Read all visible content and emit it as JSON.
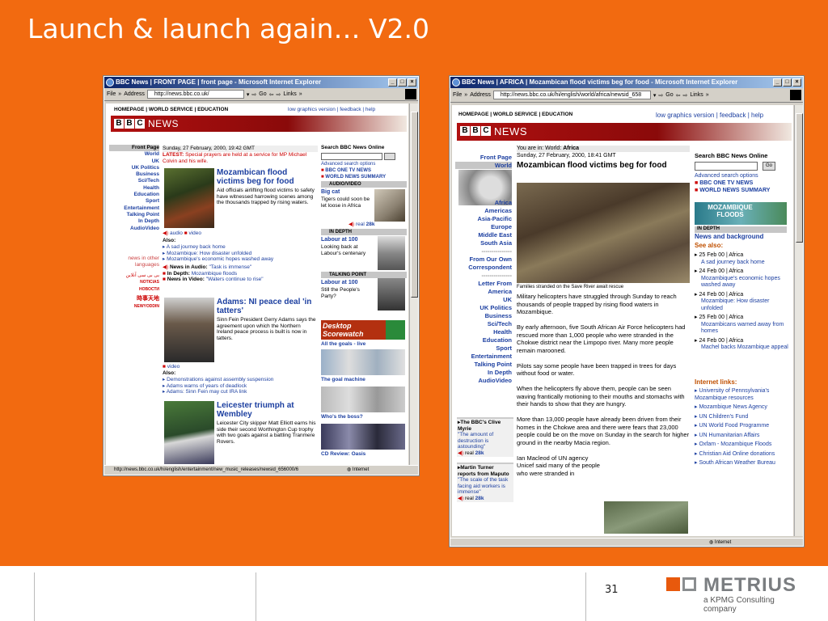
{
  "slide": {
    "title": "Launch & launch again… V2.0",
    "page_number": "31",
    "logo_word": "METRIUS",
    "logo_tag": "a KPMG Consulting company"
  },
  "colors": {
    "slide_bg": "#f26a10",
    "bbc_red": "#b01010",
    "link_blue": "#1c3fa0"
  },
  "left_window": {
    "title": "BBC News | FRONT PAGE | front page - Microsoft Internet Explorer",
    "menu_file": "File",
    "address_label": "Address",
    "address": "http://news.bbc.co.uk/",
    "go": "Go",
    "links": "Links",
    "status_url": "http://news.bbc.co.uk/hi/english/entertainment/new_music_releases/newsid_656000/6",
    "status_zone": "Internet",
    "page": {
      "topnav_left": "HOMEPAGE | WORLD SERVICE | EDUCATION",
      "topnav_right": "low graphics version | feedback | help",
      "brand": [
        "B",
        "B",
        "C"
      ],
      "news": "NEWS",
      "nav": [
        "Front Page",
        "World",
        "UK",
        "UK Politics",
        "Business",
        "Sci/Tech",
        "Health",
        "Education",
        "Sport",
        "Entertainment",
        "Talking Point",
        "In Depth",
        "AudioVideo"
      ],
      "date": "Sunday, 27 February, 2000, 19:42 GMT",
      "latest_label": "LATEST:",
      "latest_text": "Special prayers are held at a service for MP Michael Colvin and his wife.",
      "story1_head": "Mozambican flood victims beg for food",
      "story1_text": "Aid officials airlifting flood victims to safety have witnessed harrowing scenes among the thousands trapped by rising waters.",
      "audio": "audio",
      "video": "video",
      "also": "Also:",
      "also1": [
        "A sad journey back home",
        "Mozambique: How disaster unfolded",
        "Mozambique's economic hopes washed away"
      ],
      "news_in_audio_label": "News in Audio:",
      "news_in_audio": "\"Task is immense\"",
      "in_depth_label": "In Depth:",
      "in_depth": "Mozambique floods",
      "news_in_video_label": "News in Video:",
      "news_in_video": "\"Waters continue to rise\"",
      "other_lang": "news in other languages",
      "lang1": "NOTICIAS",
      "lang2": "НОВОСТИ",
      "lang3": "NEWYODDIN",
      "story2_head": "Adams: NI peace deal 'in tatters'",
      "story2_text": "Sinn Fein President Gerry Adams says the agreement upon which the Northern Ireland peace process is built is now in tatters.",
      "also2": [
        "Demonstrations against assembly suspension",
        "Adams warns of years of deadlock",
        "Adams: Sinn Fein may cut IRA link"
      ],
      "story3_head": "Leicester triumph at Wembley",
      "story3_text": "Leicester City skipper Matt Elliott earns his side their second Worthington Cup trophy with two goals against a battling Tranmere Rovers.",
      "search_label": "Search BBC News Online",
      "adv_search": "Advanced search options",
      "one_tv": "BBC ONE TV NEWS",
      "world_summary": "WORLD NEWS SUMMARY",
      "audio_video_bar": "AUDIO/VIDEO",
      "big_cat": "Big cat",
      "big_cat_text": "Tigers could soon be let loose in Africa",
      "real": "real",
      "real28": "28k",
      "in_depth_bar": "IN DEPTH",
      "labour_head": "Labour at 100",
      "labour_text": "Looking back at Labour's centenary",
      "talking_bar": "TALKING POINT",
      "labour2_head": "Labour at 100",
      "labour2_text": "Still the People's Party?",
      "desktop_ad": "Desktop Scorewatch",
      "all_goals": "All the goals - live",
      "goal_machine": "The goal machine",
      "whos_boss": "Who's the boss?",
      "cd_review": "CD Review: Oasis"
    }
  },
  "right_window": {
    "title": "BBC News | AFRICA | Mozambican flood victims beg for food - Microsoft Internet Explorer",
    "menu_file": "File",
    "address_label": "Address",
    "address": "http://news.bbc.co.uk/hi/english/world/africa/newsid_658",
    "go": "Go",
    "links": "Links",
    "status_zone": "Internet",
    "page": {
      "topnav_left": "HOMEPAGE | WORLD SERVICE | EDUCATION",
      "topnav_right": "low graphics version | feedback | help",
      "brand": [
        "B",
        "B",
        "C"
      ],
      "news": "NEWS",
      "you_are_in": "You are in:",
      "you_world": "World:",
      "you_africa": "Africa",
      "nav_top": [
        "Front Page",
        "World"
      ],
      "nav_world": [
        "Africa",
        "Americas",
        "Asia-Pacific",
        "Europe",
        "Middle East",
        "South Asia"
      ],
      "dash": "---------------",
      "from_our": "From Our Own Correspondent",
      "letter_from": "Letter From America",
      "nav_bottom": [
        "UK",
        "UK Politics",
        "Business",
        "Sci/Tech",
        "Health",
        "Education",
        "Sport",
        "Entertainment",
        "Talking Point",
        "In Depth",
        "AudioVideo"
      ],
      "date": "Sunday, 27 February, 2000, 18:41 GMT",
      "headline": "Mozambican flood victims beg for food",
      "caption": "Families stranded on the Save River await rescue",
      "p1": "Military helicopters have struggled through Sunday to reach thousands of people trapped by rising flood waters in Mozambique.",
      "p2": "By early afternoon, five South African Air Force helicopters had rescued more than 1,000 people who were stranded in the Chokwe district near the Limpopo river. Many more people remain marooned.",
      "p3": "Pilots say some people have been trapped in trees for days without food or water.",
      "p4": "When the helicopters fly above them, people can be seen waving frantically motioning to their mouths and stomachs with their hands to show that they are hungry.",
      "p5": "More than 13,000 people have already been driven from their homes in the Chokwe area and there were fears that 23,000 people could be on the move on Sunday in the search for higher ground in the nearby Macia region.",
      "p6": "Ian Macleod of UN agency Unicef said many of the people who were stranded in",
      "quote1_head": "The BBC's Clive Myrie",
      "quote1": "\"The amount of destruction is astounding\"",
      "quote2_head": "Martin Turner reports from Maputo",
      "quote2": "\"The scale of the task facing aid workers is immense\"",
      "real": "real",
      "real28": "28k",
      "search_label": "Search BBC News Online",
      "go_btn": "Go",
      "adv_search": "Advanced search options",
      "one_tv": "BBC ONE TV NEWS",
      "world_summary": "WORLD NEWS SUMMARY",
      "moz_banner": "MOZAMBIQUE FLOODS",
      "in_depth": "IN DEPTH",
      "news_bg": "News and background",
      "see_also": "See also:",
      "see_items": [
        {
          "date": "25 Feb 00 | Africa",
          "title": "A sad journey back home"
        },
        {
          "date": "24 Feb 00 | Africa",
          "title": "Mozambique's economic hopes washed away"
        },
        {
          "date": "24 Feb 00 | Africa",
          "title": "Mozambique: How disaster unfolded"
        },
        {
          "date": "25 Feb 00 | Africa",
          "title": "Mozambicans warned away from homes"
        },
        {
          "date": "24 Feb 00 | Africa",
          "title": "Machel backs Mozambique appeal"
        }
      ],
      "internet_links": "Internet links:",
      "links_list": [
        "University of Pennsylvania's Mozambique resources",
        "Mozambique News Agency",
        "UN Children's Fund",
        "UN World Food Programme",
        "UN Humanitarian Affairs",
        "Oxfam - Mozambique Floods",
        "Christian Aid Online donations",
        "South African Weather Bureau"
      ]
    }
  }
}
